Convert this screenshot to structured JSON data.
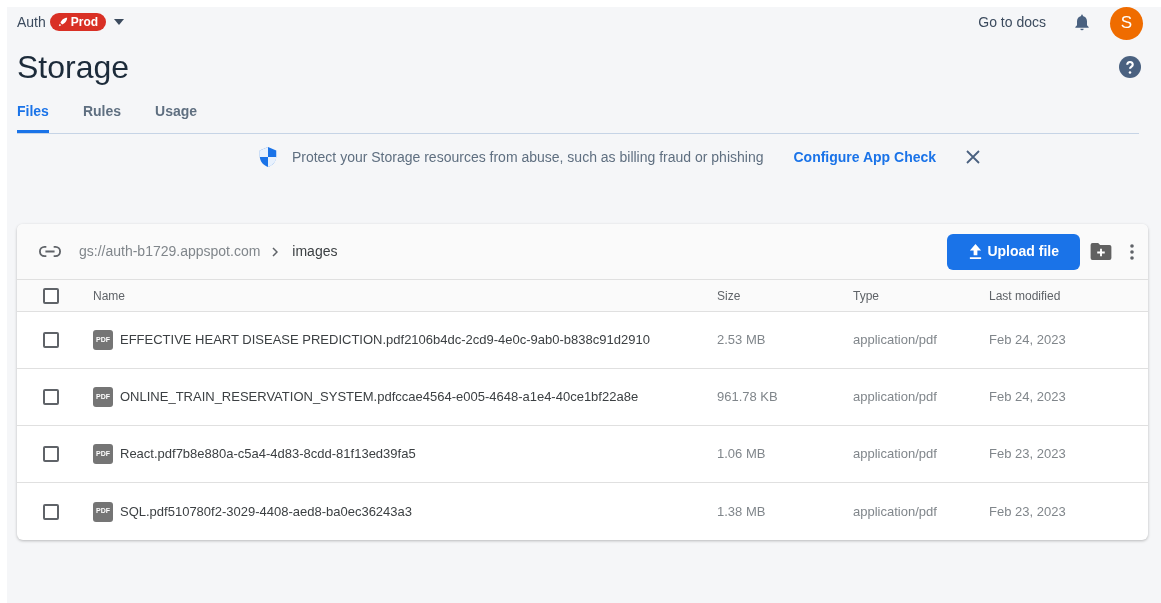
{
  "header": {
    "project": "Auth",
    "environment": "Prod",
    "docs_link": "Go to docs",
    "avatar_letter": "S"
  },
  "title": "Storage",
  "tabs": [
    {
      "label": "Files",
      "selected": true
    },
    {
      "label": "Rules",
      "selected": false
    },
    {
      "label": "Usage",
      "selected": false
    }
  ],
  "banner": {
    "text": "Protect your Storage resources from abuse, such as billing fraud or phishing",
    "link": "Configure App Check"
  },
  "browser": {
    "bucket": "gs://auth-b1729.appspot.com",
    "folder": "images",
    "upload_button": "Upload file",
    "columns": [
      "Name",
      "Size",
      "Type",
      "Last modified"
    ],
    "select_all_checked": false,
    "rows": [
      {
        "checked": false,
        "icon_label": "PDF",
        "name": "EFFECTIVE HEART DISEASE PREDICTION.pdf2106b4dc-2cd9-4e0c-9ab0-b838c91d2910",
        "size": "2.53 MB",
        "type": "application/pdf",
        "modified": "Feb 24, 2023"
      },
      {
        "checked": false,
        "icon_label": "PDF",
        "name": "ONLINE_TRAIN_RESERVATION_SYSTEM.pdfccae4564-e005-4648-a1e4-40ce1bf22a8e",
        "size": "961.78 KB",
        "type": "application/pdf",
        "modified": "Feb 24, 2023"
      },
      {
        "checked": false,
        "icon_label": "PDF",
        "name": "React.pdf7b8e880a-c5a4-4d83-8cdd-81f13ed39fa5",
        "size": "1.06 MB",
        "type": "application/pdf",
        "modified": "Feb 23, 2023"
      },
      {
        "checked": false,
        "icon_label": "PDF",
        "name": "SQL.pdf510780f2-3029-4408-aed8-ba0ec36243a3",
        "size": "1.38 MB",
        "type": "application/pdf",
        "modified": "Feb 23, 2023"
      }
    ]
  }
}
